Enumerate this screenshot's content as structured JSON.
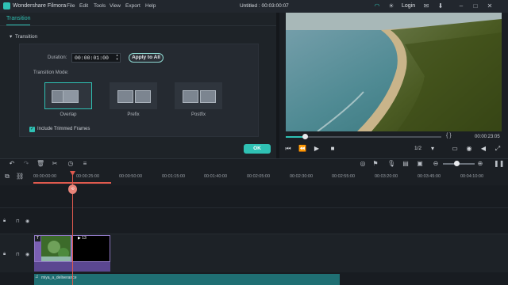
{
  "app": {
    "name": "Wondershare Filmora",
    "title": "Untitled : 00:03:00:07",
    "menu": [
      "File",
      "Edit",
      "Tools",
      "View",
      "Export",
      "Help"
    ],
    "login_label": "Login"
  },
  "panel": {
    "tab_label": "Transition",
    "section_title": "Transition",
    "duration_label": "Duration:",
    "duration_value": "00:00:01:00",
    "apply_all_label": "Apply to All",
    "mode_label": "Transition Mode:",
    "modes": [
      {
        "label": "Overlap",
        "selected": true
      },
      {
        "label": "Prefix",
        "selected": false
      },
      {
        "label": "Postfix",
        "selected": false
      }
    ],
    "include_trimmed_label": "Include Trimmed Frames",
    "include_trimmed_checked": true,
    "ok_label": "OK"
  },
  "preview": {
    "progress_fraction": 0.12,
    "timecode": "00:00:23:05",
    "ratio": "1/2",
    "brackets": "{   }"
  },
  "timeline": {
    "ruler_labels": [
      "00:00:00:00",
      "00:00:25:00",
      "00:00:50:00",
      "00:01:15:00",
      "00:01:40:00",
      "00:02:05:00",
      "00:02:30:00",
      "00:02:55:00",
      "00:03:20:00",
      "00:03:45:00",
      "00:04:10:00"
    ],
    "clip2_number": "13",
    "clip1_badge": "T",
    "audio_clip_label": "miya_a_deliverance",
    "playhead_label": "⟲"
  },
  "colors": {
    "accent": "#2fc1b4",
    "playhead": "#e05a4e",
    "clip": "#7a5fb3",
    "audio": "#1f6f73"
  }
}
